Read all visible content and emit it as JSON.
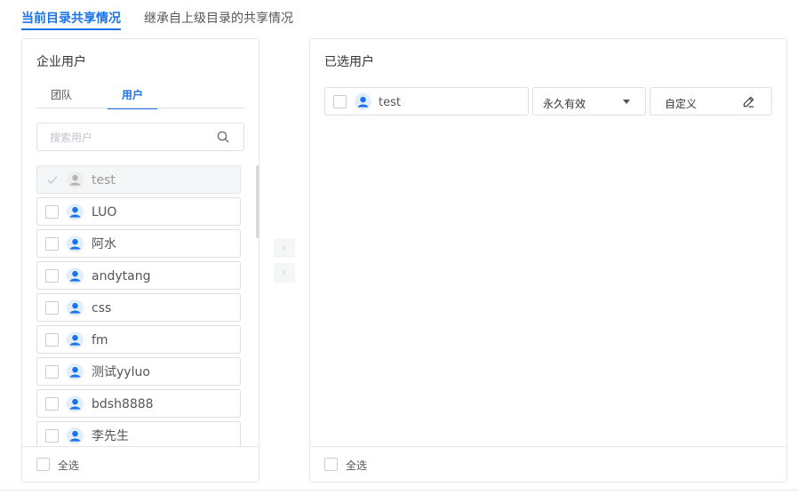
{
  "top_tabs": [
    {
      "label": "当前目录共享情况"
    },
    {
      "label": "继承自上级目录的共享情况"
    }
  ],
  "left_panel": {
    "title": "企业用户",
    "tabs": [
      {
        "label": "团队"
      },
      {
        "label": "用户"
      }
    ],
    "search": {
      "placeholder": "搜索用户",
      "value": ""
    },
    "users": [
      {
        "name": "test"
      },
      {
        "name": "LUO"
      },
      {
        "name": "阿水"
      },
      {
        "name": "andytang"
      },
      {
        "name": "css"
      },
      {
        "name": "fm"
      },
      {
        "name": "测试yyluo"
      },
      {
        "name": "bdsh8888"
      },
      {
        "name": "李先生"
      }
    ],
    "footer": {
      "select_all": "全选"
    }
  },
  "transfer": {
    "to_right": "›",
    "to_left": "‹"
  },
  "right_panel": {
    "title": "已选用户",
    "selected": [
      {
        "name": "test",
        "validity": "永久有效",
        "permission": "自定义"
      }
    ],
    "footer": {
      "select_all": "全选"
    }
  },
  "colors": {
    "accent": "#1a73e8",
    "border": "#dcdfe6",
    "avatar": "#1a73e8",
    "avatar_bg": "#e3eefc"
  }
}
